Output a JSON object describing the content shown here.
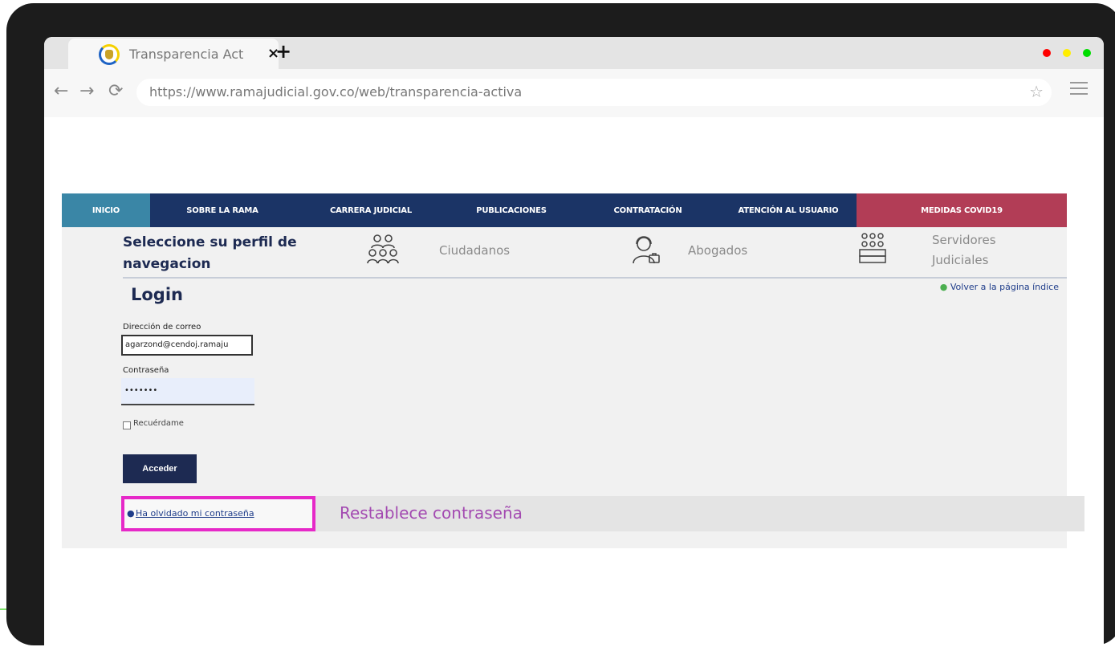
{
  "browser": {
    "tab_title": "Transparencia Act",
    "tab_close": "×",
    "new_tab": "+",
    "url": "https://www.ramajudicial.gov.co/web/transparencia-activa",
    "nav_back": "←",
    "nav_forward": "→",
    "nav_reload": "⟳",
    "star": "☆",
    "window_dots": [
      "#ff0000",
      "#ffee00",
      "#00dd00"
    ]
  },
  "navbar": {
    "items": [
      {
        "label": "INICIO",
        "color": "#3a86a6"
      },
      {
        "label": "SOBRE LA RAMA",
        "color": "#1b3466"
      },
      {
        "label": "CARRERA JUDICIAL",
        "color": "#1b3466"
      },
      {
        "label": "PUBLICACIONES",
        "color": "#1b3466"
      },
      {
        "label": "CONTRATACIÓN",
        "color": "#1b3466"
      },
      {
        "label": "ATENCIÓN AL USUARIO",
        "color": "#1b3466"
      },
      {
        "label": "MEDIDAS COVID19",
        "color": "#b23d56"
      }
    ]
  },
  "profile": {
    "title": "Seleccione su perfil de navegacion",
    "options": [
      {
        "label": "Ciudadanos",
        "icon": "citizens-icon"
      },
      {
        "label": "Abogados",
        "icon": "lawyers-icon"
      },
      {
        "label": "Servidores Judiciales",
        "icon": "judicial-servers-icon"
      }
    ]
  },
  "login": {
    "title": "Login",
    "back_link": "Volver a la página índice",
    "email_label": "Dirección de correo",
    "email_value": "agarzond@cendoj.ramaju",
    "password_label": "Contraseña",
    "password_value": "•••••••",
    "remember_label": "Recuérdame",
    "submit_label": "Acceder",
    "forgot_link": "Ha olvidado mi contraseña",
    "reset_text": "Restablece contraseña"
  },
  "colors": {
    "accent_navy": "#1d2a52",
    "highlight": "#e629c8",
    "reset_text": "#a34ab1"
  }
}
